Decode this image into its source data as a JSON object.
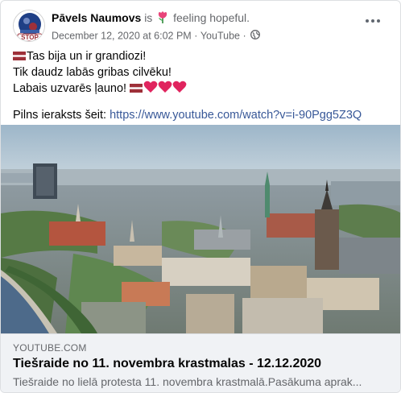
{
  "post": {
    "author_name": "Pāvels Naumovs",
    "is_text": "is",
    "feeling_text": "feeling hopeful.",
    "feeling_icon": "tulip-icon",
    "date": "December 12, 2020 at 6:02 PM",
    "separator": "·",
    "source": "YouTube",
    "audience_icon": "globe-icon",
    "avatar_text": "STOP",
    "more_icon": "more-horizontal-icon"
  },
  "message": {
    "line1": "Tas bija un ir grandiozi!",
    "line2": "Tik daudz labās gribas cilvēku!",
    "line3": "Labais uzvarēs ļauno!",
    "link_prefix": "Pilns ieraksts šeit:",
    "link_url": "https://www.youtube.com/watch?v=i-90Pgg5Z3Q",
    "emoji_flag": "latvia-flag-icon",
    "emoji_hearts": "red-heart-icon"
  },
  "link_card": {
    "domain": "YOUTUBE.COM",
    "title": "Tiešraide no 11. novembra krastmalas - 12.12.2020",
    "description": "Tiešraide no lielā protesta 11. novembra krastmalā.Pasākuma aprak..."
  },
  "colors": {
    "link": "#385898",
    "secondary_text": "#65676b",
    "card_bg": "#f0f2f5",
    "flag_red": "#9e3039",
    "heart_red": "#e0245e"
  }
}
